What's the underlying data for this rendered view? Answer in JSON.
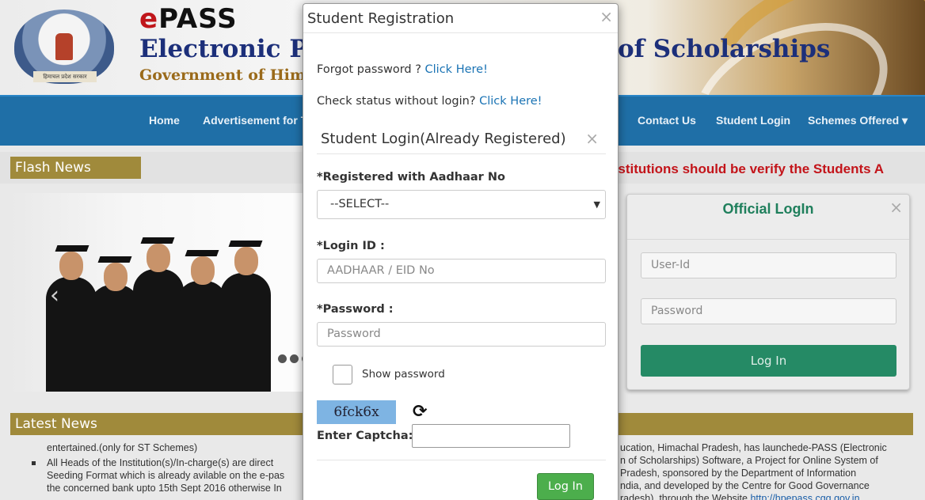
{
  "header": {
    "brand_e": "e",
    "brand_pass": "PASS",
    "subtitle_left": "Electronic Payı",
    "subtitle_right": "of Scholarships",
    "gov_line": "Government of Hima",
    "emblem_text": "हिमाचल प्रदेश सरकार"
  },
  "nav": {
    "items": [
      "Home",
      "Advertisement for T",
      "Contact Us",
      "Student Login",
      "Schemes Offered ▾"
    ]
  },
  "flash": {
    "label": "Flash News",
    "marquee": "nstitutions should be verify the Students A"
  },
  "slider": {
    "arrow": "‹"
  },
  "official_login": {
    "title": "Official  LogIn",
    "close": "×",
    "user_placeholder": "User-Id",
    "password_placeholder": "Password",
    "button": "Log In"
  },
  "latest": {
    "label": "Latest News",
    "left_lines": [
      "entertained.(only for ST Schemes)",
      "All Heads of the Institution(s)/In-charge(s) are direct",
      "Seeding Format which is already avilable on the e-pas",
      "the concerned bank upto 15th Sept 2016 otherwise In"
    ],
    "right_lines": [
      "ucation, Himachal Pradesh, has launchede-PASS (Electronic",
      "n of Scholarships) Software, a Project for Online System of",
      "Pradesh, sponsored by the Department of Information",
      "ndia, and developed by the Centre for Good Governance",
      "radesh), through the Website"
    ],
    "right_link": "http://hpepass.cgg.gov.in"
  },
  "modal": {
    "title": "Student Registration",
    "close": "×",
    "forgot_text": "Forgot password ? ",
    "forgot_link": "Click Here!",
    "status_text": "Check status without login? ",
    "status_link": "Click Here!",
    "sub_title": "Student Login(Already Registered)",
    "sub_close": "×",
    "aadhaar_label": "*Registered with Aadhaar No",
    "aadhaar_select": "--SELECT--",
    "login_id_label": "*Login ID :",
    "login_id_placeholder": "AADHAAR / EID No",
    "password_label": "*Password :",
    "password_placeholder": "Password",
    "show_password": "Show password",
    "captcha_value": "6fck6x",
    "captcha_label": "Enter Captcha:",
    "login_button": "Log In"
  }
}
